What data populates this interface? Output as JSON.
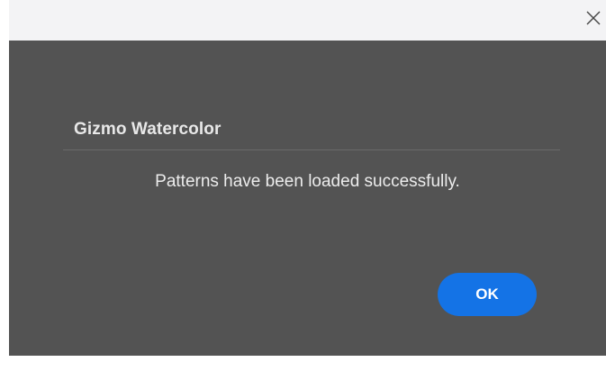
{
  "window": {
    "close_icon": "close-icon"
  },
  "dialog": {
    "title": "Gizmo Watercolor",
    "message": "Patterns have been loaded successfully.",
    "ok_label": "OK"
  },
  "colors": {
    "dialog_background": "#535353",
    "titlebar_background": "#f3f3f5",
    "accent": "#1473e6",
    "text": "#ececec"
  }
}
